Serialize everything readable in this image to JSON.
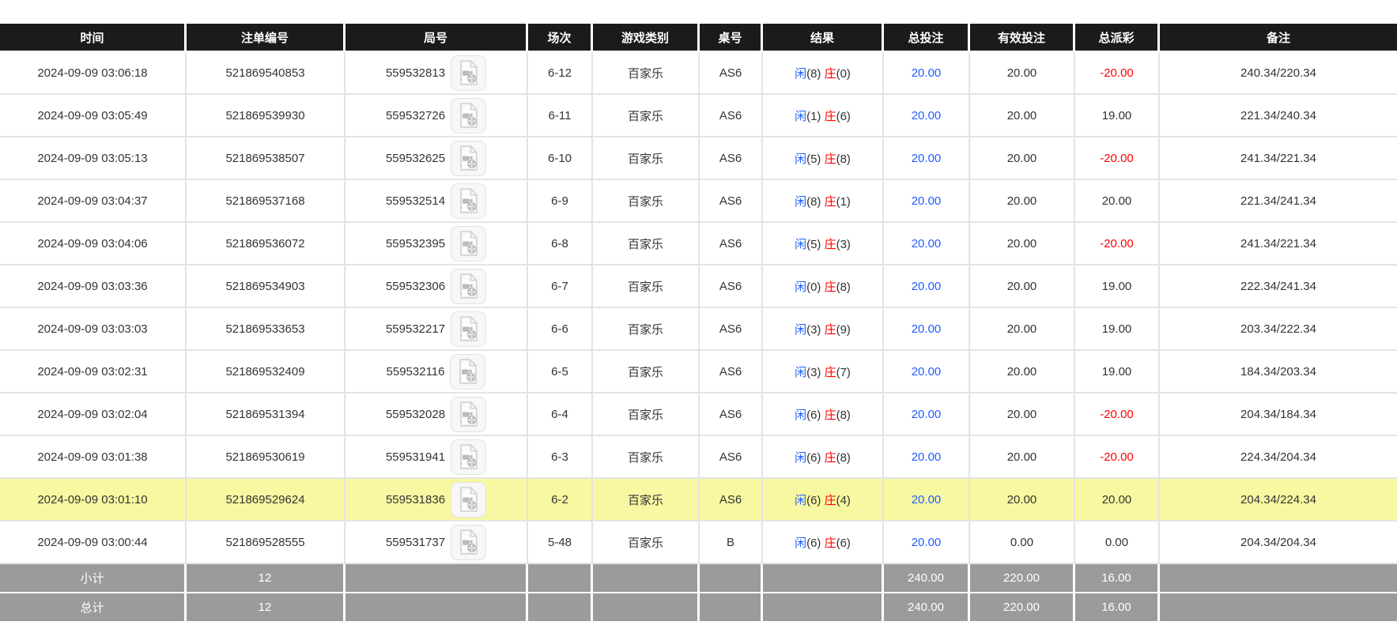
{
  "colors": {
    "header_bg": "#1b1b1b",
    "header_text": "#ffffff",
    "body_text": "#333333",
    "bet_blue": "#1f5fff",
    "loss_red": "#ff0000",
    "highlight_row_bg": "#f8f8a2",
    "footer_bg": "#9b9b9b",
    "grid_line": "#e4e4e4"
  },
  "table": {
    "columns": [
      {
        "key": "time",
        "label": "时间"
      },
      {
        "key": "order-id",
        "label": "注单编号"
      },
      {
        "key": "round-id",
        "label": "局号"
      },
      {
        "key": "session",
        "label": "场次"
      },
      {
        "key": "game-type",
        "label": "游戏类别"
      },
      {
        "key": "table-no",
        "label": "桌号"
      },
      {
        "key": "result",
        "label": "结果"
      },
      {
        "key": "total-bet",
        "label": "总投注"
      },
      {
        "key": "valid-bet",
        "label": "有效投注"
      },
      {
        "key": "payout",
        "label": "总派彩"
      },
      {
        "key": "remark",
        "label": "备注"
      }
    ],
    "result_labels": {
      "player": "闲",
      "banker": "庄"
    },
    "video_icon": "video-file-icon",
    "rows": [
      {
        "time": "2024-09-09 03:06:18",
        "order_id": "521869540853",
        "round_id": "559532813",
        "session": "6-12",
        "game": "百家乐",
        "table_no": "AS6",
        "player": "8",
        "banker": "0",
        "total_bet": "20.00",
        "valid_bet": "20.00",
        "payout": "-20.00",
        "remark": "240.34/220.34",
        "highlighted": false
      },
      {
        "time": "2024-09-09 03:05:49",
        "order_id": "521869539930",
        "round_id": "559532726",
        "session": "6-11",
        "game": "百家乐",
        "table_no": "AS6",
        "player": "1",
        "banker": "6",
        "total_bet": "20.00",
        "valid_bet": "20.00",
        "payout": "19.00",
        "remark": "221.34/240.34",
        "highlighted": false
      },
      {
        "time": "2024-09-09 03:05:13",
        "order_id": "521869538507",
        "round_id": "559532625",
        "session": "6-10",
        "game": "百家乐",
        "table_no": "AS6",
        "player": "5",
        "banker": "8",
        "total_bet": "20.00",
        "valid_bet": "20.00",
        "payout": "-20.00",
        "remark": "241.34/221.34",
        "highlighted": false
      },
      {
        "time": "2024-09-09 03:04:37",
        "order_id": "521869537168",
        "round_id": "559532514",
        "session": "6-9",
        "game": "百家乐",
        "table_no": "AS6",
        "player": "8",
        "banker": "1",
        "total_bet": "20.00",
        "valid_bet": "20.00",
        "payout": "20.00",
        "remark": "221.34/241.34",
        "highlighted": false
      },
      {
        "time": "2024-09-09 03:04:06",
        "order_id": "521869536072",
        "round_id": "559532395",
        "session": "6-8",
        "game": "百家乐",
        "table_no": "AS6",
        "player": "5",
        "banker": "3",
        "total_bet": "20.00",
        "valid_bet": "20.00",
        "payout": "-20.00",
        "remark": "241.34/221.34",
        "highlighted": false
      },
      {
        "time": "2024-09-09 03:03:36",
        "order_id": "521869534903",
        "round_id": "559532306",
        "session": "6-7",
        "game": "百家乐",
        "table_no": "AS6",
        "player": "0",
        "banker": "8",
        "total_bet": "20.00",
        "valid_bet": "20.00",
        "payout": "19.00",
        "remark": "222.34/241.34",
        "highlighted": false
      },
      {
        "time": "2024-09-09 03:03:03",
        "order_id": "521869533653",
        "round_id": "559532217",
        "session": "6-6",
        "game": "百家乐",
        "table_no": "AS6",
        "player": "3",
        "banker": "9",
        "total_bet": "20.00",
        "valid_bet": "20.00",
        "payout": "19.00",
        "remark": "203.34/222.34",
        "highlighted": false
      },
      {
        "time": "2024-09-09 03:02:31",
        "order_id": "521869532409",
        "round_id": "559532116",
        "session": "6-5",
        "game": "百家乐",
        "table_no": "AS6",
        "player": "3",
        "banker": "7",
        "total_bet": "20.00",
        "valid_bet": "20.00",
        "payout": "19.00",
        "remark": "184.34/203.34",
        "highlighted": false
      },
      {
        "time": "2024-09-09 03:02:04",
        "order_id": "521869531394",
        "round_id": "559532028",
        "session": "6-4",
        "game": "百家乐",
        "table_no": "AS6",
        "player": "6",
        "banker": "8",
        "total_bet": "20.00",
        "valid_bet": "20.00",
        "payout": "-20.00",
        "remark": "204.34/184.34",
        "highlighted": false
      },
      {
        "time": "2024-09-09 03:01:38",
        "order_id": "521869530619",
        "round_id": "559531941",
        "session": "6-3",
        "game": "百家乐",
        "table_no": "AS6",
        "player": "6",
        "banker": "8",
        "total_bet": "20.00",
        "valid_bet": "20.00",
        "payout": "-20.00",
        "remark": "224.34/204.34",
        "highlighted": false
      },
      {
        "time": "2024-09-09 03:01:10",
        "order_id": "521869529624",
        "round_id": "559531836",
        "session": "6-2",
        "game": "百家乐",
        "table_no": "AS6",
        "player": "6",
        "banker": "4",
        "total_bet": "20.00",
        "valid_bet": "20.00",
        "payout": "20.00",
        "remark": "204.34/224.34",
        "highlighted": true
      },
      {
        "time": "2024-09-09 03:00:44",
        "order_id": "521869528555",
        "round_id": "559531737",
        "session": "5-48",
        "game": "百家乐",
        "table_no": "B",
        "player": "6",
        "banker": "6",
        "total_bet": "20.00",
        "valid_bet": "0.00",
        "payout": "0.00",
        "remark": "204.34/204.34",
        "highlighted": false
      }
    ],
    "footers": [
      {
        "label": "小计",
        "count": "12",
        "total_bet": "240.00",
        "valid_bet": "220.00",
        "payout": "16.00"
      },
      {
        "label": "总计",
        "count": "12",
        "total_bet": "240.00",
        "valid_bet": "220.00",
        "payout": "16.00"
      }
    ]
  }
}
